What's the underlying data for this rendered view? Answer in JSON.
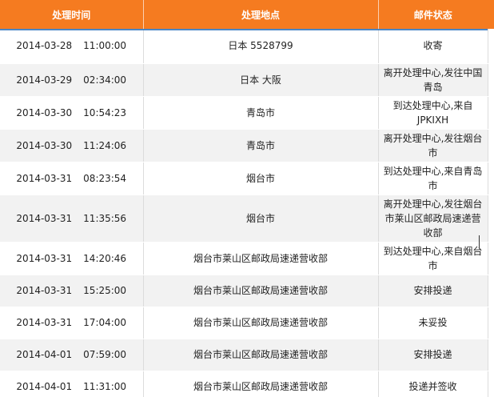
{
  "header": {
    "col_time": "处理时间",
    "col_location": "处理地点",
    "col_status": "邮件状态"
  },
  "rows": [
    {
      "date": "2014-03-28",
      "time": "11:00:00",
      "location": "日本 5528799",
      "status": "收寄"
    },
    {
      "date": "2014-03-29",
      "time": "02:34:00",
      "location": "日本 大阪",
      "status": "离开处理中心,发往中国 青岛"
    },
    {
      "date": "2014-03-30",
      "time": "10:54:23",
      "location": "青岛市",
      "status": "到达处理中心,来自JPKIXH"
    },
    {
      "date": "2014-03-30",
      "time": "11:24:06",
      "location": "青岛市",
      "status": "离开处理中心,发往烟台市"
    },
    {
      "date": "2014-03-31",
      "time": "08:23:54",
      "location": "烟台市",
      "status": "到达处理中心,来自青岛市"
    },
    {
      "date": "2014-03-31",
      "time": "11:35:56",
      "location": "烟台市",
      "status": "离开处理中心,发往烟台市莱山区邮政局速递营收部"
    },
    {
      "date": "2014-03-31",
      "time": "14:20:46",
      "location": "烟台市莱山区邮政局速递营收部",
      "status": "到达处理中心,来自烟台市"
    },
    {
      "date": "2014-03-31",
      "time": "15:25:00",
      "location": "烟台市莱山区邮政局速递营收部",
      "status": "安排投递"
    },
    {
      "date": "2014-03-31",
      "time": "17:04:00",
      "location": "烟台市莱山区邮政局速递营收部",
      "status": "未妥投"
    },
    {
      "date": "2014-04-01",
      "time": "07:59:00",
      "location": "烟台市莱山区邮政局速递营收部",
      "status": "安排投递"
    },
    {
      "date": "2014-04-01",
      "time": "11:31:00",
      "location": "烟台市莱山区邮政局速递营收部",
      "status": "投递并签收"
    }
  ],
  "colors": {
    "header_bg": "#f57b20",
    "header_text": "#ffffff",
    "header_underline": "#4a86c5",
    "row_alt_bg": "#f2f2f2"
  }
}
